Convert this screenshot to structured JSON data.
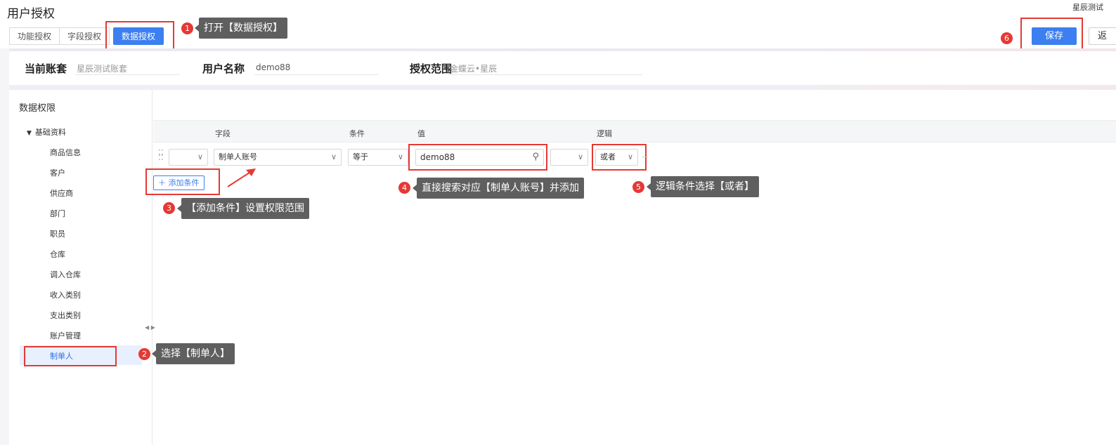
{
  "page": {
    "title": "用户授权",
    "account_corner": "星辰测试"
  },
  "tabs": [
    {
      "label": "功能授权"
    },
    {
      "label": "字段授权"
    },
    {
      "label": "数据授权"
    }
  ],
  "header_actions": {
    "save_label": "保存",
    "back_label": "返"
  },
  "info": {
    "account_label": "当前账套",
    "account_value": "星辰测试账套",
    "user_label": "用户名称",
    "user_value": "demo88",
    "scope_label": "授权范围",
    "scope_value": "金蝶云•星辰"
  },
  "tree": {
    "header": "数据权限",
    "group_label": "基础资料",
    "items": [
      "商品信息",
      "客户",
      "供应商",
      "部门",
      "职员",
      "仓库",
      "调入仓库",
      "收入类别",
      "支出类别",
      "账户管理",
      "制单人"
    ]
  },
  "table": {
    "columns": {
      "field": "字段",
      "condition": "条件",
      "value": "值",
      "logic": "逻辑"
    },
    "row": {
      "field": "制单人账号",
      "condition": "等于",
      "value": "demo88",
      "logic": "或者"
    },
    "add_condition": "添加条件"
  },
  "annotations": [
    {
      "num": "1",
      "text": "打开【数据授权】"
    },
    {
      "num": "2",
      "text": "选择【制单人】"
    },
    {
      "num": "3",
      "text": "【添加条件】设置权限范围"
    },
    {
      "num": "4",
      "text": "直接搜索对应【制单人账号】并添加"
    },
    {
      "num": "5",
      "text": "逻辑条件选择【或者】"
    },
    {
      "num": "6",
      "text": ""
    }
  ],
  "colors": {
    "accent": "#3c7ff0",
    "highlight": "#e53935",
    "tooltip_bg": "#5f5f5f"
  }
}
